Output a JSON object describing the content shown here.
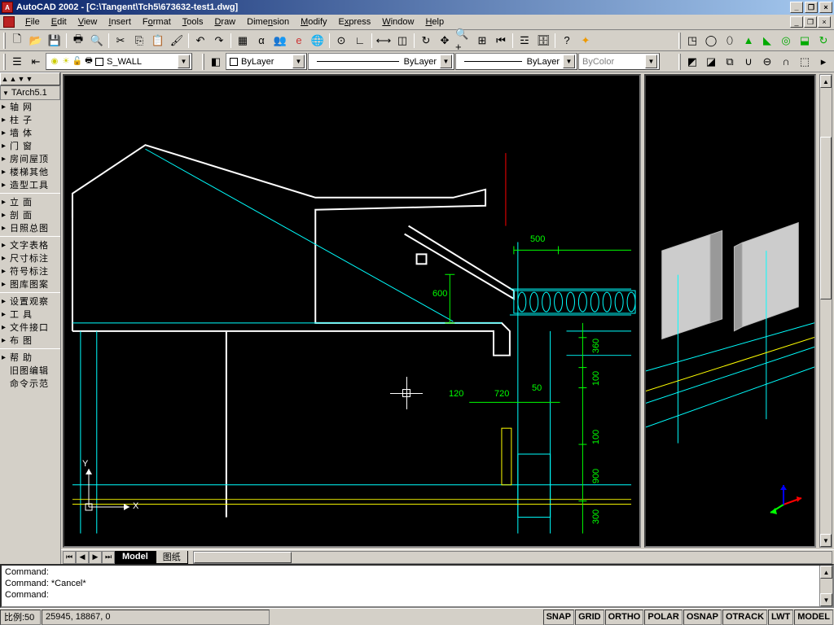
{
  "title": "AutoCAD 2002 - [C:\\Tangent\\Tch5\\673632-test1.dwg]",
  "menus": [
    "File",
    "Edit",
    "View",
    "Insert",
    "Format",
    "Tools",
    "Draw",
    "Dimension",
    "Modify",
    "Express",
    "Window",
    "Help"
  ],
  "layer": {
    "current": "S_WALL",
    "color_label": "ByLayer",
    "linetype_label": "ByLayer",
    "lineweight_label": "ByLayer",
    "plotstyle_label": "ByColor"
  },
  "palette": {
    "title": "TArch5.1",
    "groups": [
      [
        "轴    网",
        "柱    子",
        "墙    体",
        "门    窗",
        "房间屋顶",
        "楼梯其他",
        "造型工具"
      ],
      [
        "立    面",
        "剖    面",
        "日照总图"
      ],
      [
        "文字表格",
        "尺寸标注",
        "符号标注",
        "图库图案"
      ],
      [
        "设置观察",
        "工    具",
        "文件接口",
        "布    图"
      ],
      [
        "帮    助",
        "旧图编辑",
        "命令示范"
      ]
    ]
  },
  "tabs": {
    "active": "Model",
    "others": [
      "图纸"
    ]
  },
  "command": {
    "line1": "Command:",
    "line2": "Command:  *Cancel*",
    "line3": "Command:"
  },
  "status": {
    "scale": "比例:50",
    "coords": "25945, 18867, 0",
    "toggles": [
      "SNAP",
      "GRID",
      "ORTHO",
      "POLAR",
      "OSNAP",
      "OTRACK",
      "LWT",
      "MODEL"
    ]
  },
  "dims": {
    "d500": "500",
    "d600": "600",
    "d120": "120",
    "d720": "720",
    "d50": "50",
    "d360": "360",
    "d100a": "100",
    "d100b": "100",
    "d900": "900",
    "d300": "300"
  },
  "axis": {
    "x": "X",
    "y": "Y"
  }
}
